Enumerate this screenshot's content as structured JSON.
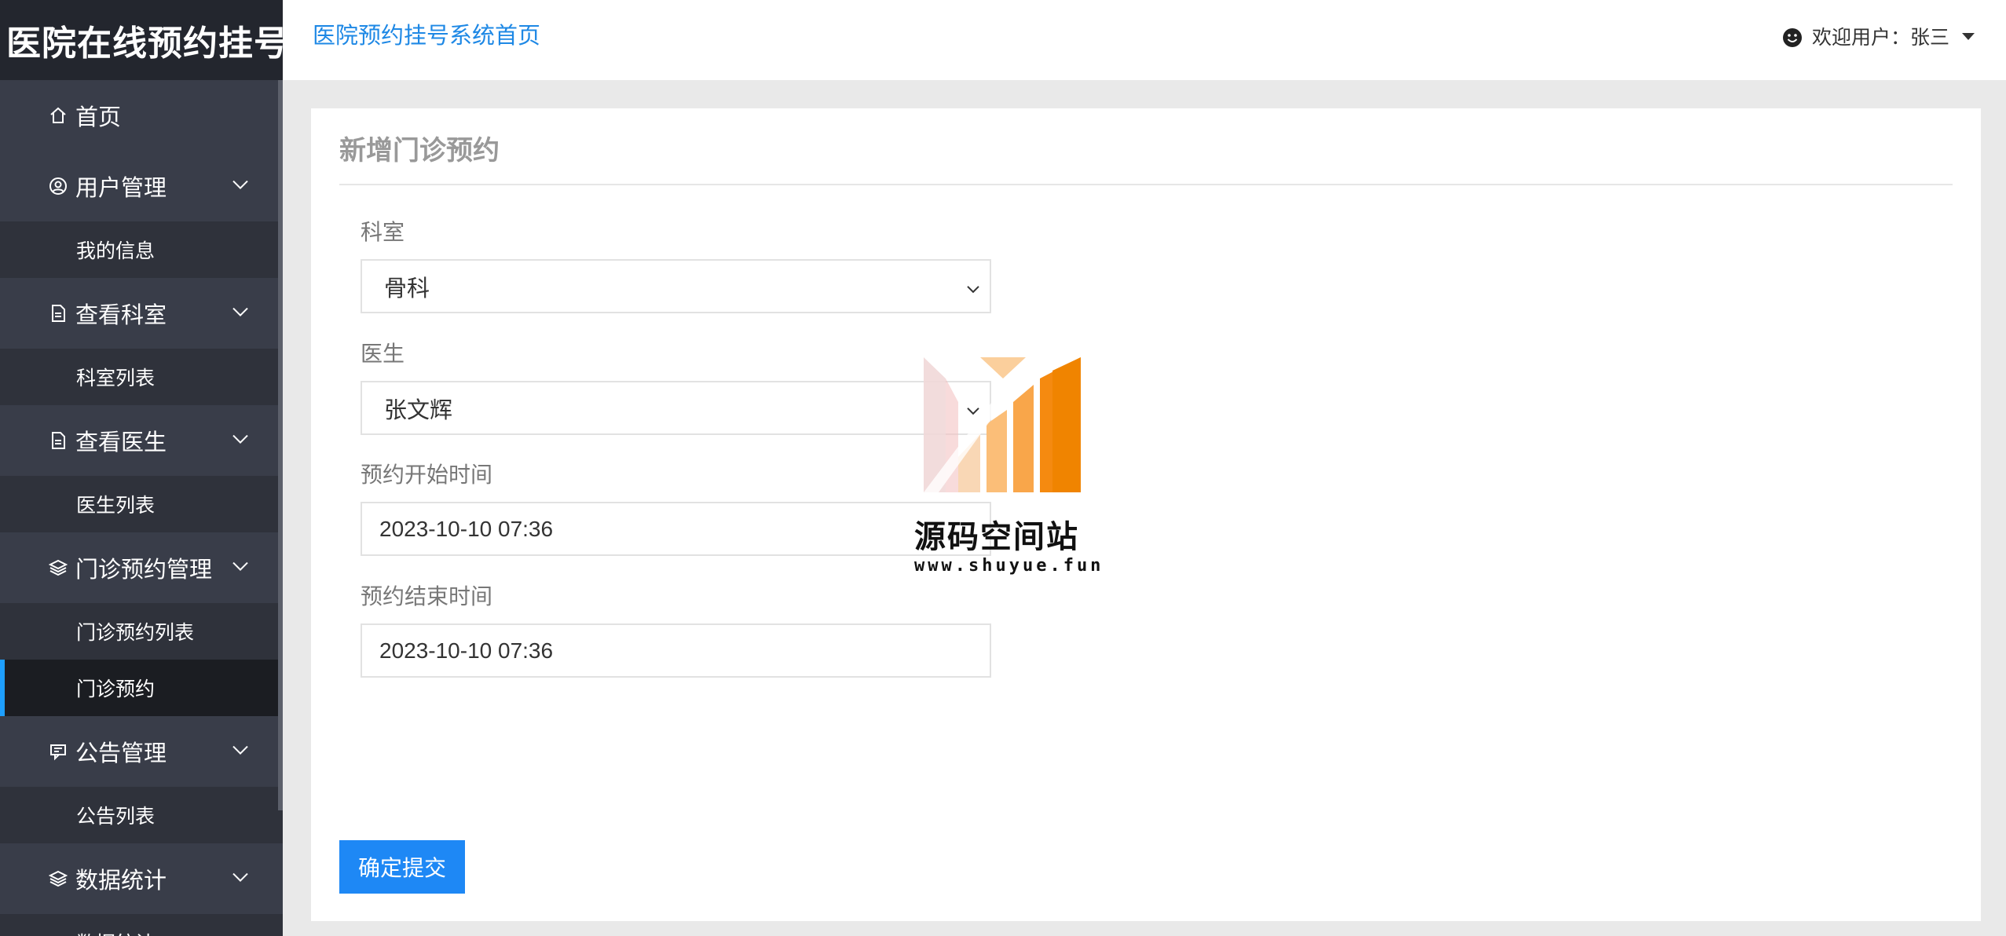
{
  "brand": {
    "title": "医院在线预约挂号"
  },
  "header": {
    "home_link": "医院预约挂号系统首页",
    "user_greeting": "欢迎用户：张三"
  },
  "sidebar": {
    "items": [
      {
        "label": "首页",
        "icon": "home-icon"
      },
      {
        "label": "用户管理",
        "icon": "user-circle-icon",
        "sub": "我的信息"
      },
      {
        "label": "查看科室",
        "icon": "document-icon",
        "sub": "科室列表"
      },
      {
        "label": "查看医生",
        "icon": "document-icon",
        "sub": "医生列表"
      },
      {
        "label": "门诊预约管理",
        "icon": "layers-icon",
        "sub1": "门诊预约列表",
        "sub2": "门诊预约"
      },
      {
        "label": "公告管理",
        "icon": "announcement-icon",
        "sub": "公告列表"
      },
      {
        "label": "数据统计",
        "icon": "layers-icon",
        "sub": "数据统计"
      }
    ],
    "active_item": "门诊预约"
  },
  "form": {
    "title": "新增门诊预约",
    "department_label": "科室",
    "department_value": "骨科",
    "doctor_label": "医生",
    "doctor_value": "张文辉",
    "start_label": "预约开始时间",
    "start_value": "2023-10-10 07:36",
    "end_label": "预约结束时间",
    "end_value": "2023-10-10 07:36",
    "submit_label": "确定提交"
  },
  "watermark": {
    "name": "源码空间站",
    "url": "www.shuyue.fun"
  },
  "colors": {
    "sidebar_bg": "#393d49",
    "accent": "#1e88f5",
    "active_bar": "#1e9fff"
  }
}
